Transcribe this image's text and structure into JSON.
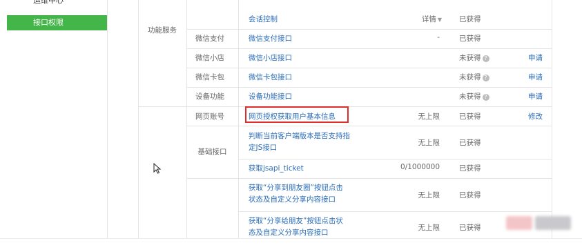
{
  "sidebar": {
    "cut_item": "运维中心",
    "active_item": "接口权限"
  },
  "sections": {
    "func_service": "功能服务",
    "basic_api": "基础接口"
  },
  "rows": [
    {
      "sub": "",
      "name": "会话控制",
      "limit": "详情",
      "status": "已获得",
      "action": ""
    },
    {
      "sub": "微信支付",
      "name": "微信支付接口",
      "limit": "-",
      "status": "已获得",
      "action": ""
    },
    {
      "sub": "微信小店",
      "name": "微信小店接口",
      "limit": "",
      "status": "未获得",
      "action": "申请"
    },
    {
      "sub": "微信卡包",
      "name": "微信卡包接口",
      "limit": "",
      "status": "未获得",
      "action": "申请"
    },
    {
      "sub": "设备功能",
      "name": "设备功能接口",
      "limit": "",
      "status": "未获得",
      "action": "申请"
    },
    {
      "sub": "网页账号",
      "name": "网页授权获取用户基本信息",
      "limit": "无上限",
      "status": "已获得",
      "action": "修改"
    },
    {
      "sub": "",
      "name_l1": "判断当前客户端版本是否支持指",
      "name_l2": "定JS接口",
      "limit": "无上限",
      "status": "已获得",
      "action": ""
    },
    {
      "sub": "",
      "name": "获取jsapi_ticket",
      "limit": "0/1000000",
      "status": "已获得",
      "action": ""
    },
    {
      "sub": "",
      "name_l1": "获取“分享到朋友圈”按钮点击",
      "name_l2": "状态及自定义分享内容接口",
      "limit": "无上限",
      "status": "已获得",
      "action": ""
    },
    {
      "sub": "",
      "name_l1": "获取“分享给朋友”按钮点击状",
      "name_l2": "态及自定义分享内容接口",
      "limit": "无上限",
      "status": "已获得",
      "action": ""
    }
  ],
  "icons": {
    "question": "?",
    "caret": "▼"
  },
  "colors": {
    "active_green": "#44b549",
    "link_blue": "#2a6cb8",
    "highlight_red": "#e02b2b"
  }
}
